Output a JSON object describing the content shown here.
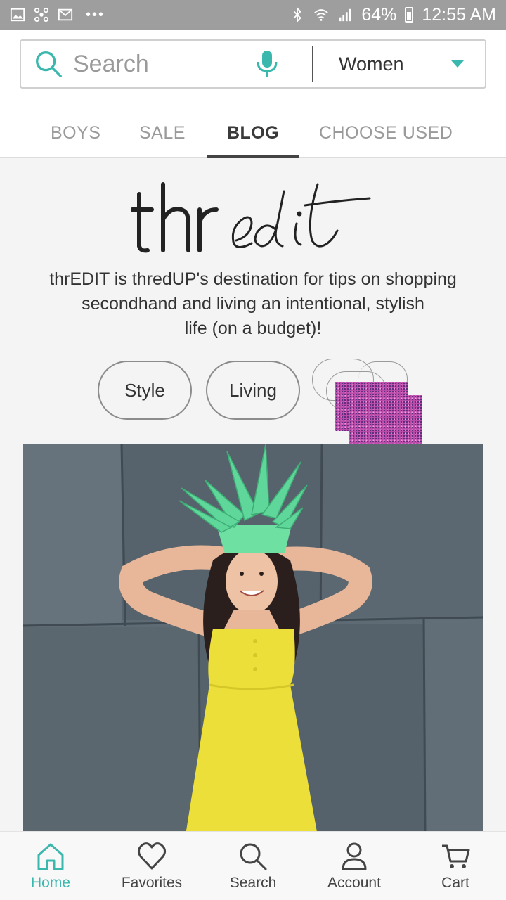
{
  "status_bar": {
    "battery": "64%",
    "time": "12:55 AM",
    "icons": [
      "image-icon",
      "fan-icon",
      "gmail-icon",
      "more-dots-icon",
      "bluetooth-icon",
      "wifi-icon",
      "signal-icon",
      "battery-icon"
    ]
  },
  "search": {
    "placeholder": "Search",
    "department": "Women"
  },
  "tabs": [
    {
      "label": "BOYS"
    },
    {
      "label": "SALE"
    },
    {
      "label": "BLOG",
      "active": true
    },
    {
      "label": "CHOOSE USED"
    }
  ],
  "blog": {
    "tagline_line1": "thrEDIT is thredUP's destination for tips on shopping",
    "tagline_line2": "secondhand and living an intentional, stylish",
    "tagline_line3": "life (on a budget)!",
    "chips": [
      "Style",
      "Living"
    ],
    "logo_text": "thredit"
  },
  "bottom_nav": [
    {
      "label": "Home",
      "icon": "home-icon",
      "active": true
    },
    {
      "label": "Favorites",
      "icon": "heart-icon"
    },
    {
      "label": "Search",
      "icon": "search-icon"
    },
    {
      "label": "Account",
      "icon": "person-icon"
    },
    {
      "label": "Cart",
      "icon": "cart-icon"
    }
  ],
  "colors": {
    "accent": "#3bb8ae",
    "statusbar": "#9e9e9e",
    "dress": "#ecdf3a",
    "pineapple_hat": "#5fd69a"
  }
}
